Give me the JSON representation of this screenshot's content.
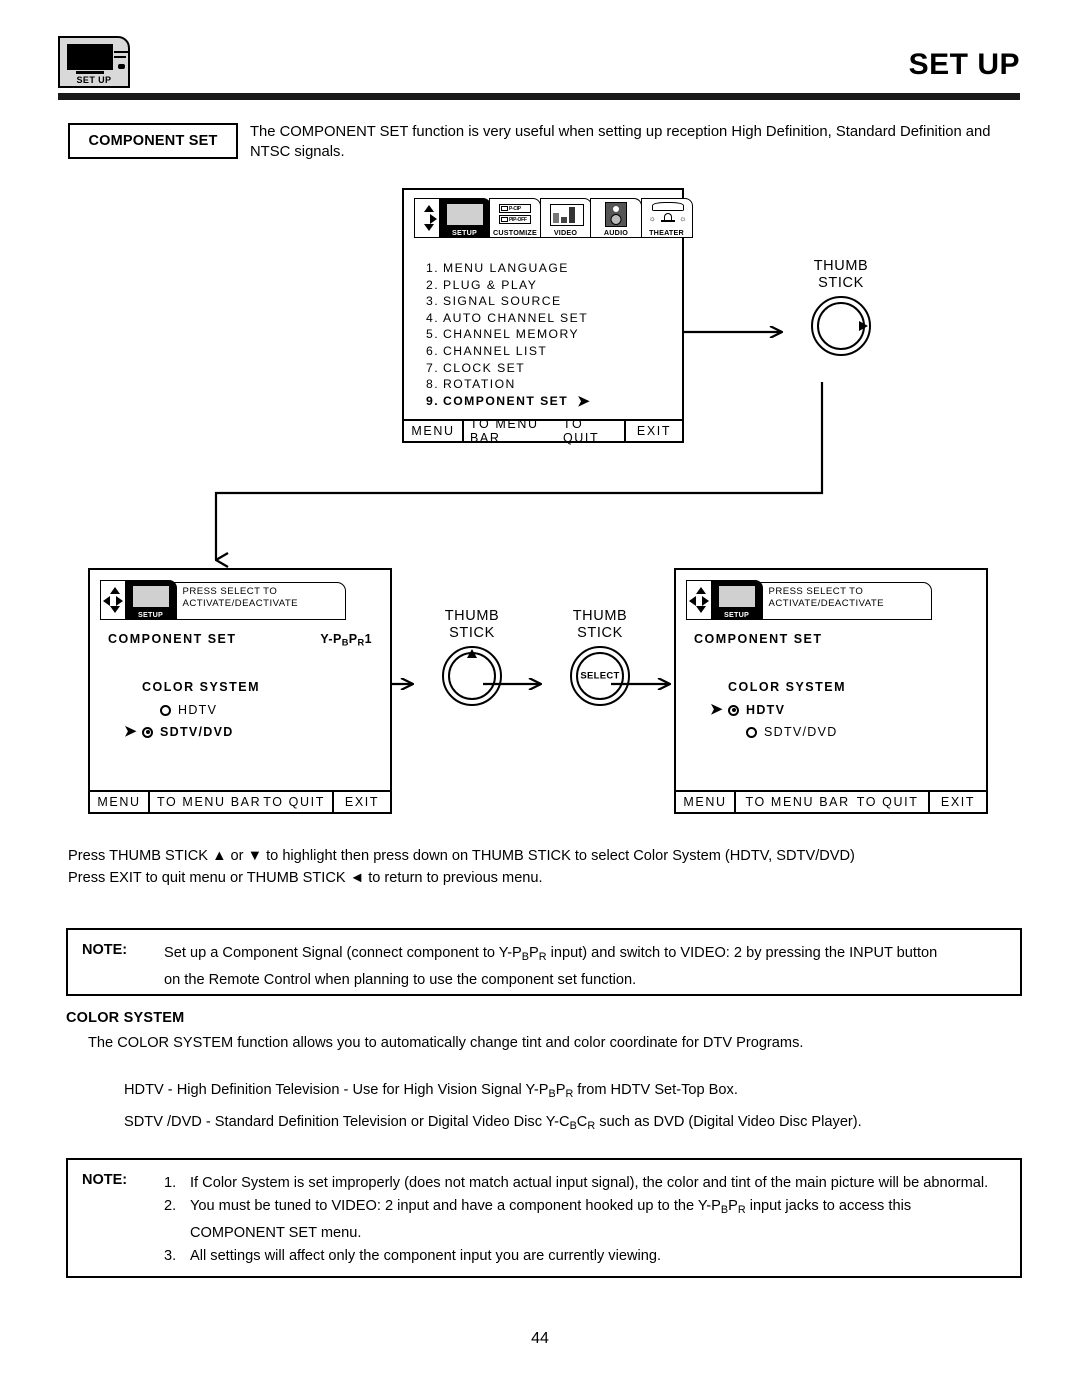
{
  "header": {
    "tab_label": "SET UP",
    "title": "SET UP"
  },
  "intro": {
    "box_label": "COMPONENT SET",
    "text": "The COMPONENT SET function is very useful when setting up reception High Definition, Standard Definition and NTSC signals."
  },
  "icon_strip": {
    "items": [
      {
        "name": "setup",
        "label": "SETUP",
        "active": true
      },
      {
        "name": "customize",
        "label": "CUSTOMIZE",
        "active": false
      },
      {
        "name": "video",
        "label": "VIDEO",
        "active": false
      },
      {
        "name": "audio",
        "label": "AUDIO",
        "active": false
      },
      {
        "name": "theater",
        "label": "THEATER",
        "active": false
      }
    ],
    "pip_labels": {
      "line1": "P-CIP",
      "line2": "PIP-OFF"
    }
  },
  "main_menu": {
    "items": [
      {
        "num": "1.",
        "label": "MENU LANGUAGE",
        "selected": false
      },
      {
        "num": "2.",
        "label": "PLUG & PLAY",
        "selected": false
      },
      {
        "num": "3.",
        "label": "SIGNAL SOURCE",
        "selected": false
      },
      {
        "num": "4.",
        "label": "AUTO CHANNEL SET",
        "selected": false
      },
      {
        "num": "5.",
        "label": "CHANNEL MEMORY",
        "selected": false
      },
      {
        "num": "6.",
        "label": "CHANNEL LIST",
        "selected": false
      },
      {
        "num": "7.",
        "label": "CLOCK SET",
        "selected": false
      },
      {
        "num": "8.",
        "label": "ROTATION",
        "selected": false
      },
      {
        "num": "9.",
        "label": "COMPONENT SET",
        "selected": true
      }
    ],
    "bottom_bar": {
      "menu": "MENU",
      "to_menu_bar": "TO MENU BAR",
      "to_quit": "TO QUIT",
      "exit": "EXIT"
    }
  },
  "thumb_sticks": {
    "top": {
      "line1": "THUMB",
      "line2": "STICK",
      "indicator": "right-arrow"
    },
    "mid_left": {
      "line1": "THUMB",
      "line2": "STICK",
      "indicator": "up-arrow"
    },
    "mid_right": {
      "line1": "THUMB",
      "line2": "STICK",
      "indicator": "SELECT"
    }
  },
  "osd_left": {
    "hint": "PRESS SELECT TO ACTIVATE/DEACTIVATE",
    "hint_line1": "PRESS SELECT TO",
    "hint_line2": "ACTIVATE/DEACTIVATE",
    "title": "COMPONENT SET",
    "input_label": "Y-PBPR1",
    "color_system_label": "COLOR SYSTEM",
    "options": [
      {
        "label": "HDTV",
        "selected": false,
        "pointer": false
      },
      {
        "label": "SDTV/DVD",
        "selected": true,
        "pointer": true
      }
    ],
    "bottom_bar": {
      "menu": "MENU",
      "to_menu_bar": "TO MENU BAR",
      "to_quit": "TO QUIT",
      "exit": "EXIT"
    }
  },
  "osd_right": {
    "hint_line1": "PRESS SELECT TO",
    "hint_line2": "ACTIVATE/DEACTIVATE",
    "title": "COMPONENT SET",
    "color_system_label": "COLOR SYSTEM",
    "options": [
      {
        "label": "HDTV",
        "selected": true,
        "pointer": true
      },
      {
        "label": "SDTV/DVD",
        "selected": false,
        "pointer": false
      }
    ],
    "bottom_bar": {
      "menu": "MENU",
      "to_menu_bar": "TO MENU BAR",
      "to_quit": "TO QUIT",
      "exit": "EXIT"
    }
  },
  "press_instructions": {
    "line1": "Press THUMB STICK ▲ or ▼ to highlight then press down on THUMB STICK to select Color System (HDTV, SDTV/DVD)",
    "line2": "Press EXIT to quit menu or THUMB STICK ◄ to return to previous menu."
  },
  "note1": {
    "label": "NOTE:",
    "line1_a": "Set up a Component Signal (connect component to Y-P",
    "line1_b": "B",
    "line1_c": "P",
    "line1_d": "R",
    "line1_e": " input) and switch to VIDEO:  2 by pressing the INPUT button",
    "line2": "on the Remote Control when planning to use the component set function."
  },
  "color_system_section": {
    "heading": "COLOR SYSTEM",
    "paragraph": "The COLOR SYSTEM function allows you to automatically change tint and color coordinate for DTV Programs.",
    "hdtv_a": "HDTV - High Definition Television - Use for High Vision Signal Y-P",
    "hdtv_sub1": "B",
    "hdtv_mid": "P",
    "hdtv_sub2": "R",
    "hdtv_b": " from HDTV Set-Top Box.",
    "sdtv_a": "SDTV /DVD - Standard Definition Television or Digital Video Disc Y-C",
    "sdtv_sub1": "B",
    "sdtv_mid": "C",
    "sdtv_sub2": "R",
    "sdtv_b": " such as DVD (Digital Video Disc Player)."
  },
  "note2": {
    "label": "NOTE:",
    "items": [
      {
        "n": "1.",
        "text": "If Color System is set improperly (does not match actual input signal), the color and tint of the main picture will be abnormal."
      },
      {
        "n": "2.",
        "text_a": "You must be tuned to VIDEO: 2 input and have a component hooked up to the Y-P",
        "sub1": "B",
        "mid": "P",
        "sub2": "R",
        "text_b": " input jacks to access this COMPONENT SET menu."
      },
      {
        "n": "3.",
        "text": "All settings will affect only the component input you are currently viewing."
      }
    ]
  },
  "page_number": "44",
  "colors": {
    "ink": "#000000",
    "paper": "#ffffff",
    "rule": "#1a1a1a",
    "screen_fill": "#d0d0d0"
  }
}
